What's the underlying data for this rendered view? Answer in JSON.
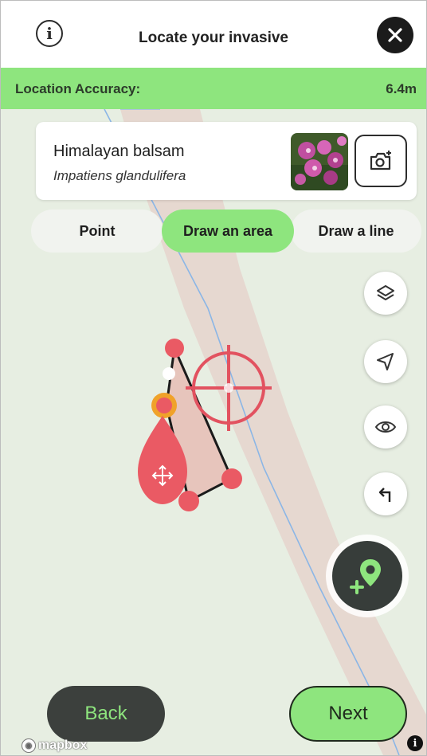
{
  "header": {
    "title": "Locate your invasive",
    "info_icon": "info-icon",
    "close_icon": "close-icon"
  },
  "accuracy": {
    "label": "Location Accuracy:",
    "value": "6.4m"
  },
  "species": {
    "common_name": "Himalayan balsam",
    "latin_name": "Impatiens glandulifera",
    "photo_icon": "flower-photo",
    "camera_icon": "camera-add-icon"
  },
  "modes": {
    "point": "Point",
    "area": "Draw an area",
    "line": "Draw a line",
    "selected": "Draw an area"
  },
  "side_controls": [
    "layers-icon",
    "navigate-icon",
    "eye-icon",
    "undo-icon"
  ],
  "fab_icon": "add-location-icon",
  "footer": {
    "back": "Back",
    "next": "Next"
  },
  "attribution": {
    "brand": "mapbox",
    "info": "i"
  },
  "colors": {
    "accent_green": "#8ee57e",
    "marker_red": "#ea5a64",
    "dark": "#373d3a",
    "highlight_orange": "#f0a22a"
  }
}
